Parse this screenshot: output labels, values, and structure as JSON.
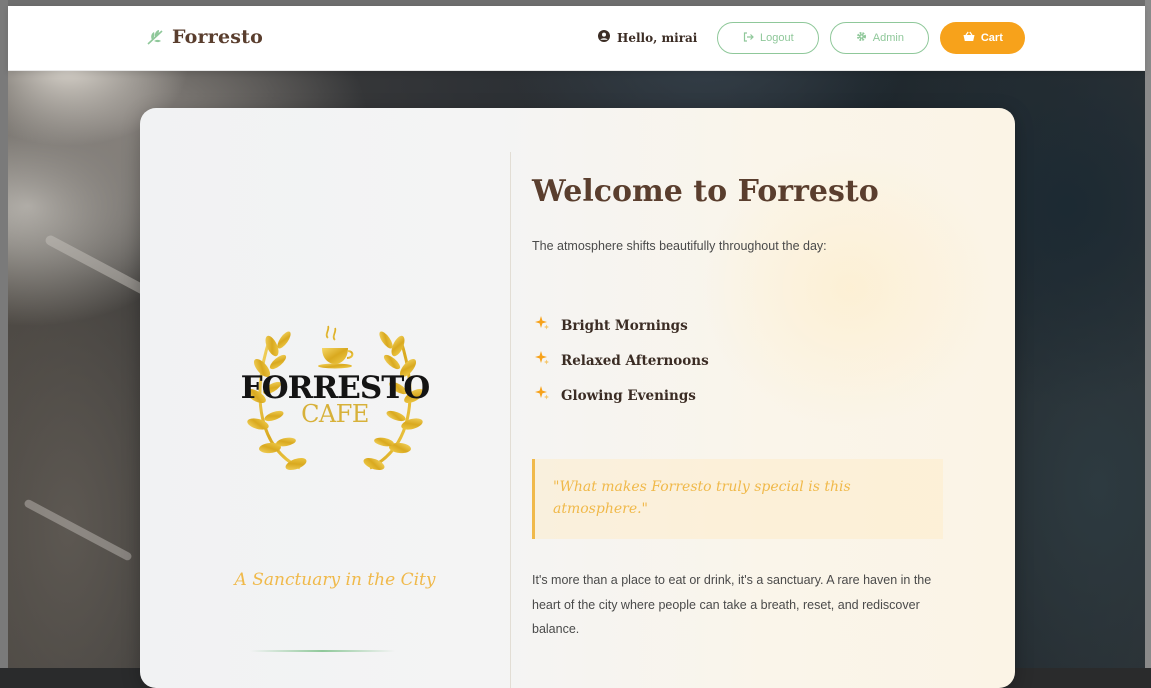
{
  "navbar": {
    "brand": "Forresto",
    "greeting": "Hello, mirai",
    "logout_label": "Logout",
    "admin_label": "Admin",
    "cart_label": "Cart"
  },
  "hero": {
    "logo_line1": "FORRESTO",
    "logo_line2": "CAFE",
    "tagline": "A Sanctuary in the City",
    "title": "Welcome to Forresto",
    "intro": "The atmosphere shifts beautifully throughout the day:",
    "features": [
      {
        "label": "Bright Mornings"
      },
      {
        "label": "Relaxed Afternoons"
      },
      {
        "label": "Glowing Evenings"
      }
    ],
    "quote": "\"What makes Forresto truly special is this atmosphere.\"",
    "paragraph": "It's more than a place to eat or drink, it's a sanctuary. A rare haven in the heart of the city where people can take a breath, reset, and rediscover balance."
  },
  "icons": {
    "brand": "leaf-icon",
    "greeting": "user-circle-icon",
    "logout": "logout-icon",
    "admin": "gear-icon",
    "cart": "basket-icon",
    "feature": "sparkle-icon"
  },
  "colors": {
    "brand": "#5a3e2e",
    "accent": "#f7a21b",
    "green": "#8fc89a",
    "gold": "#f0b94a"
  }
}
